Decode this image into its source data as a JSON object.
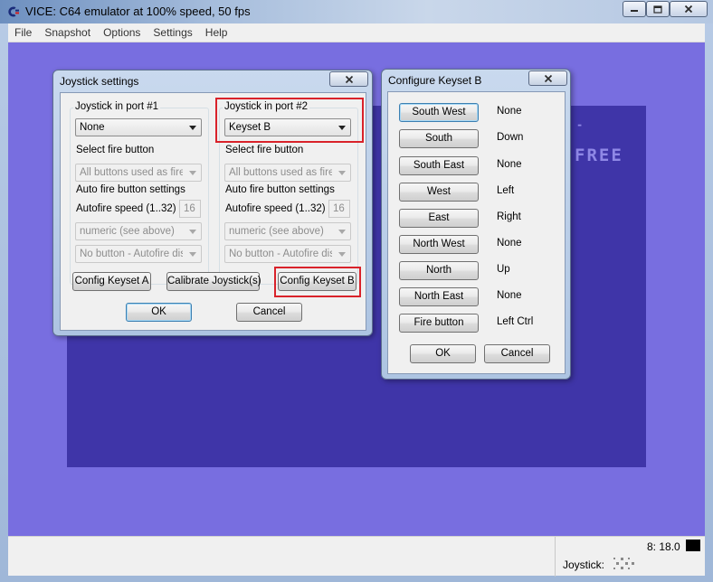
{
  "window": {
    "title": "VICE: C64 emulator at 100% speed, 50 fps",
    "controls": {
      "minimize": "minimize-icon",
      "maximize": "maximize-icon",
      "close": "close-icon"
    }
  },
  "menu": [
    "File",
    "Snapshot",
    "Options",
    "Settings",
    "Help"
  ],
  "screen": {
    "text_partial": "FREE",
    "border_color": "#786ee0",
    "background_color": "#3f35a8",
    "text_color": "#8f88e6"
  },
  "status": {
    "time": "8: 18.0",
    "joystick_label": "Joystick:"
  },
  "joystick_dialog": {
    "title": "Joystick settings",
    "port1": {
      "group_title": "Joystick in port #1",
      "device": "None",
      "fire_label": "Select fire button",
      "fire_value": "All buttons used as fire",
      "autofire_label": "Auto fire button settings",
      "speed_label": "Autofire speed (1..32)",
      "speed_value": "16",
      "mode_value": "numeric (see above)",
      "autofire_button_value": "No button - Autofire disabled"
    },
    "port2": {
      "group_title": "Joystick in port #2",
      "device": "Keyset B",
      "fire_label": "Select fire button",
      "fire_value": "All buttons used as fire",
      "autofire_label": "Auto fire button settings",
      "speed_label": "Autofire speed (1..32)",
      "speed_value": "16",
      "mode_value": "numeric (see above)",
      "autofire_button_value": "No button - Autofire disabled"
    },
    "buttons": {
      "config_a": "Config Keyset A",
      "calibrate": "Calibrate Joystick(s)",
      "config_b": "Config Keyset B",
      "ok": "OK",
      "cancel": "Cancel"
    },
    "highlight_color": "#d9222a"
  },
  "keyset_dialog": {
    "title": "Configure Keyset B",
    "rows": [
      {
        "label": "South West",
        "value": "None"
      },
      {
        "label": "South",
        "value": "Down"
      },
      {
        "label": "South East",
        "value": "None"
      },
      {
        "label": "West",
        "value": "Left"
      },
      {
        "label": "East",
        "value": "Right"
      },
      {
        "label": "North West",
        "value": "None"
      },
      {
        "label": "North",
        "value": "Up"
      },
      {
        "label": "North East",
        "value": "None"
      },
      {
        "label": "Fire button",
        "value": "Left Ctrl"
      }
    ],
    "ok": "OK",
    "cancel": "Cancel"
  }
}
